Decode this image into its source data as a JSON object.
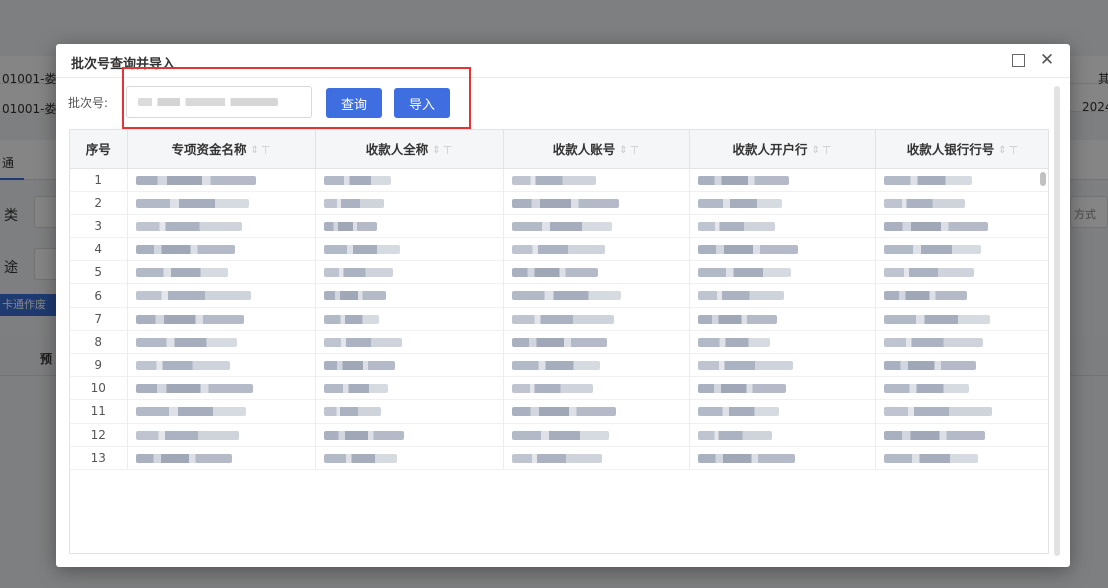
{
  "background": {
    "row1_text": "01001-娄",
    "row2_text": "01001-娄",
    "right1_text": "其",
    "right2_text": "2024",
    "field_label_1": "类",
    "field_label_2": "途",
    "right_field_text": "方式",
    "tag_text": "卡通作废",
    "tab_text": "通",
    "head_text": "预"
  },
  "dialog": {
    "title": "批次号查询并导入",
    "batch_label": "批次号:",
    "batch_value": "",
    "query_button": "查询",
    "import_button": "导入"
  },
  "table": {
    "columns": [
      "序号",
      "专项资金名称",
      "收款人全称",
      "收款人账号",
      "收款人开户行",
      "收款人银行行号"
    ],
    "rows": [
      "1",
      "2",
      "3",
      "4",
      "5",
      "6",
      "7",
      "8",
      "9",
      "10",
      "11",
      "12",
      "13"
    ]
  },
  "colors": {
    "accent": "#3e6ee0",
    "highlight": "#e23535"
  }
}
